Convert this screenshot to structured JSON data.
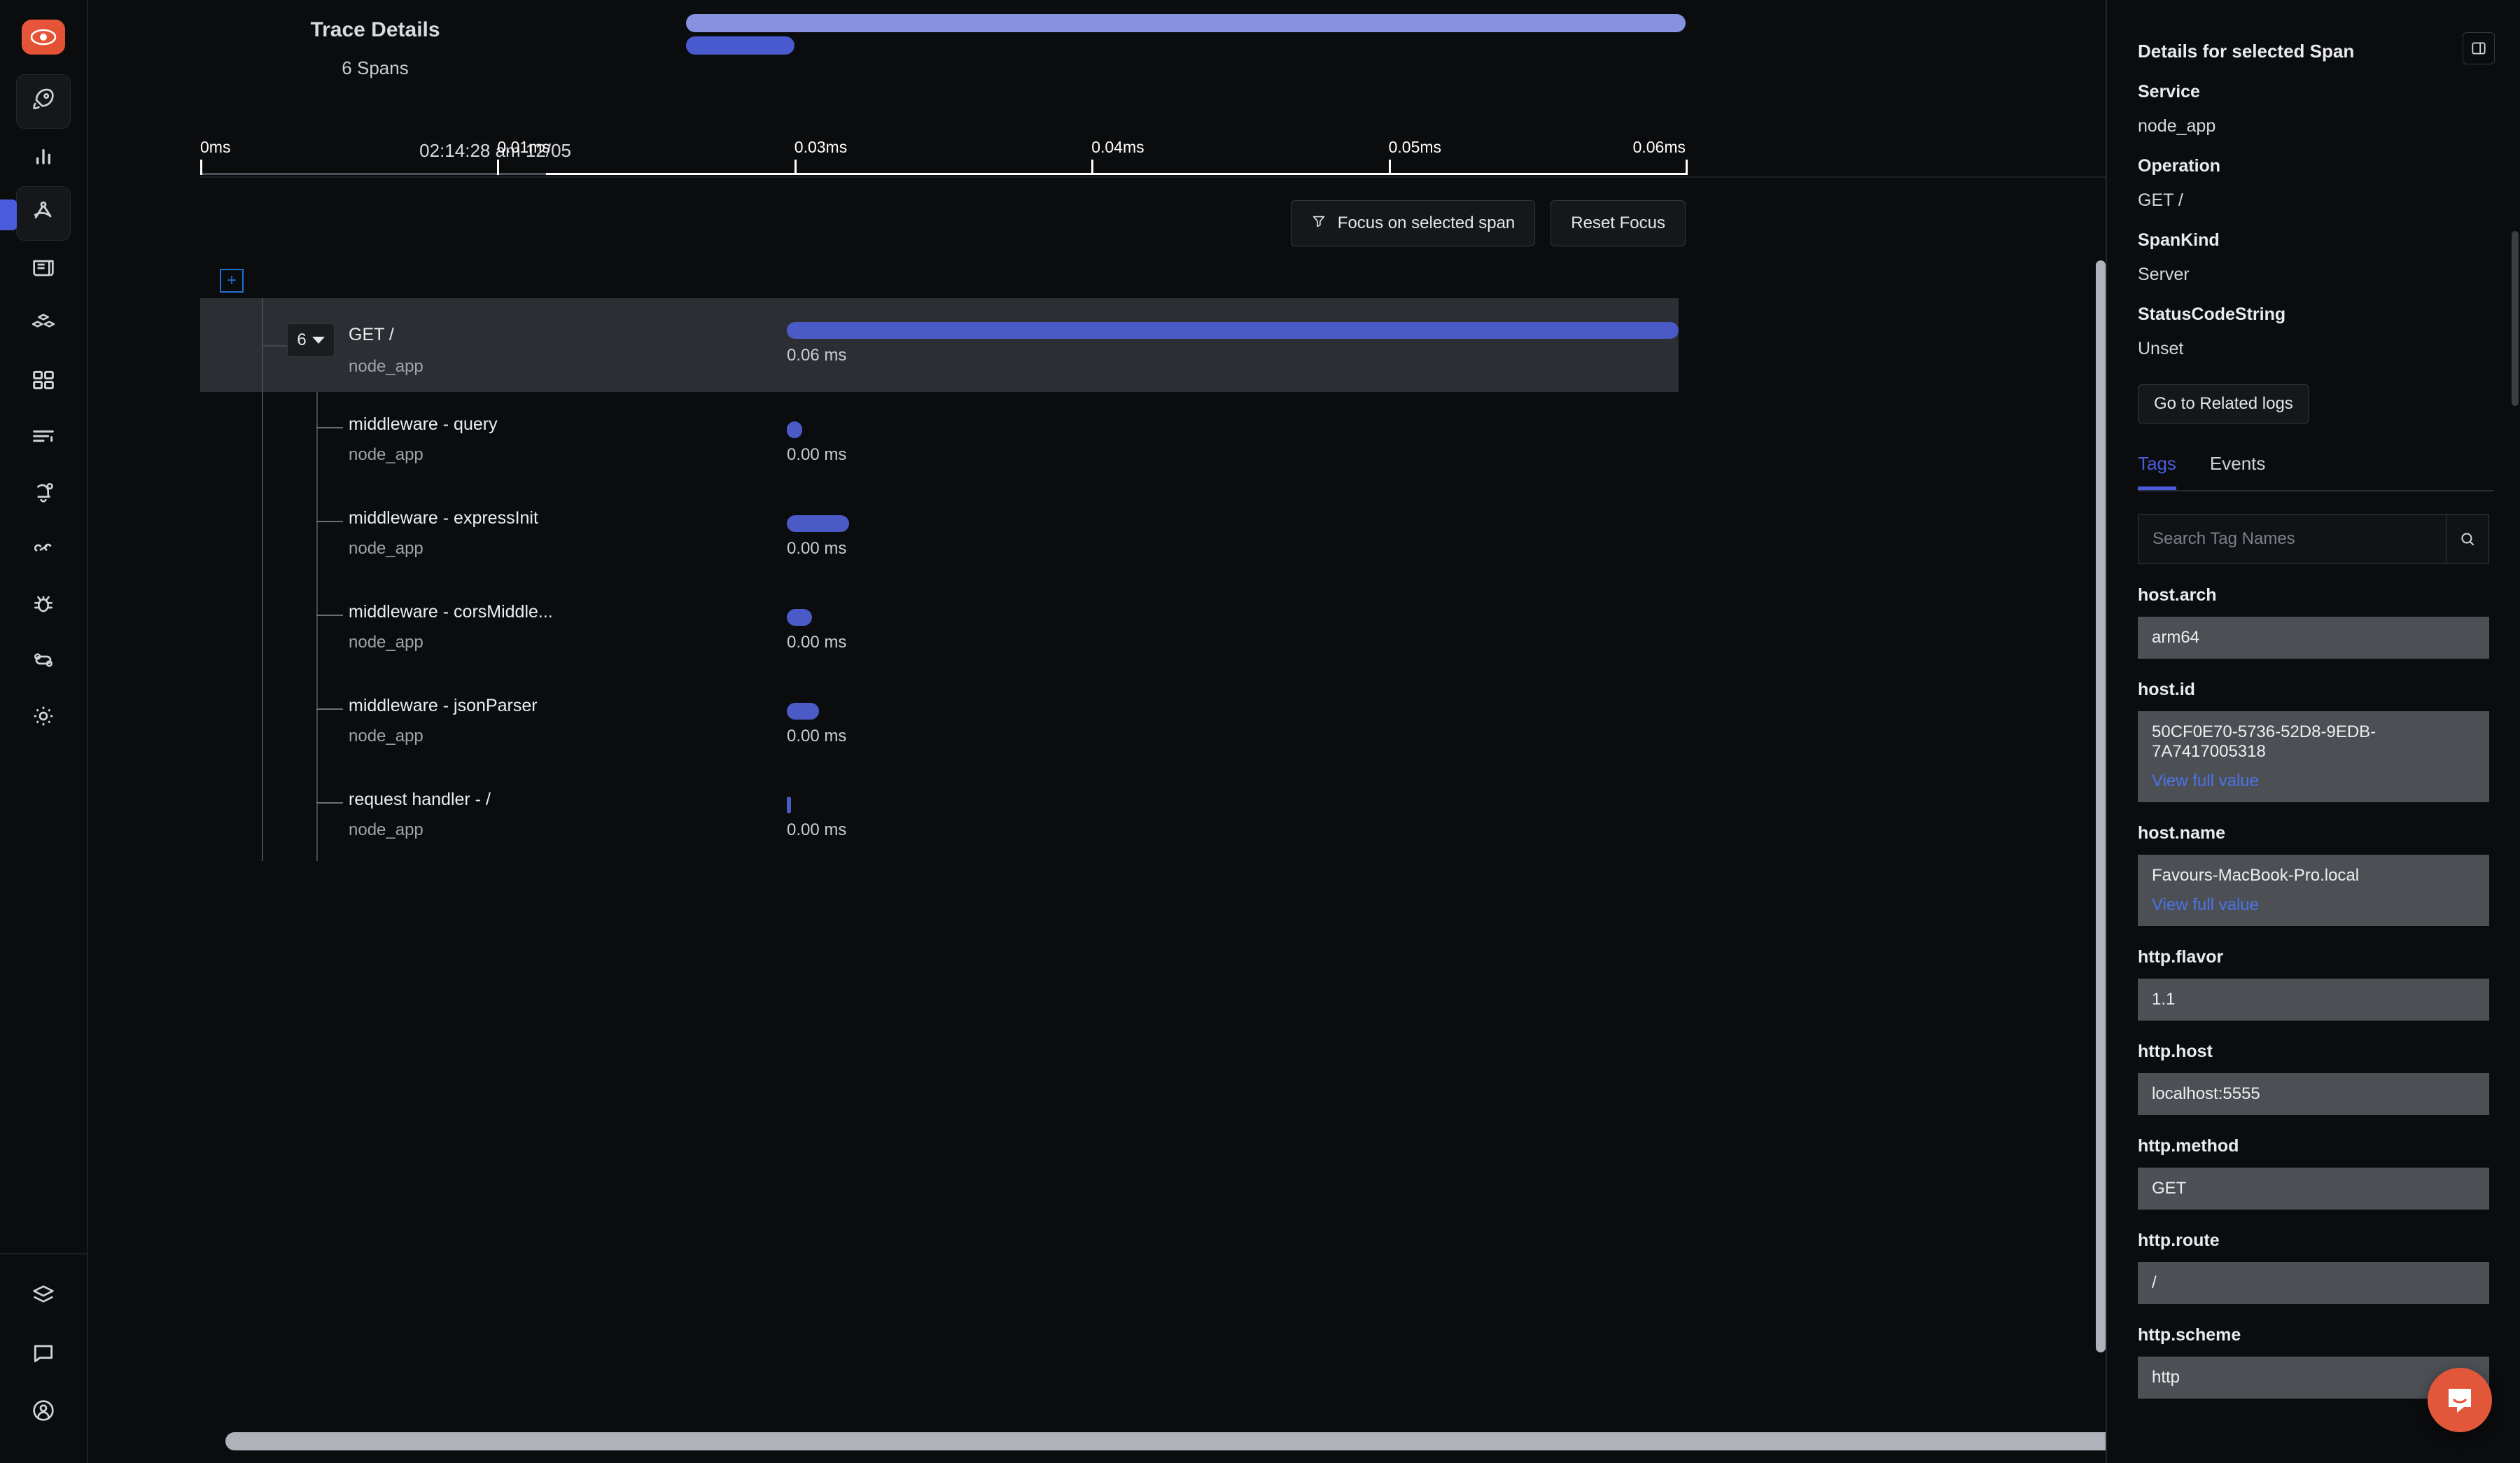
{
  "sidebar": {
    "logo_icon": "eye-logo-icon",
    "items": [
      {
        "icon": "rocket-icon",
        "name": "get-started",
        "active": false,
        "boxed": true
      },
      {
        "icon": "bar-chart-icon",
        "name": "metrics",
        "active": false,
        "boxed": false
      },
      {
        "icon": "traces-icon",
        "name": "traces",
        "active": true,
        "boxed": true
      },
      {
        "icon": "logs-icon",
        "name": "logs",
        "active": false,
        "boxed": false
      },
      {
        "icon": "cubes-icon",
        "name": "services",
        "active": false,
        "boxed": false
      },
      {
        "icon": "dashboard-grid-icon",
        "name": "dashboards",
        "active": false,
        "boxed": false
      },
      {
        "icon": "list-lines-icon",
        "name": "exceptions",
        "active": false,
        "boxed": false
      },
      {
        "icon": "bell-icon",
        "name": "alerts",
        "active": false,
        "boxed": false
      },
      {
        "icon": "pipeline-icon",
        "name": "pipelines",
        "active": false,
        "boxed": false
      },
      {
        "icon": "bug-icon",
        "name": "errors",
        "active": false,
        "boxed": false
      },
      {
        "icon": "workflow-icon",
        "name": "workflows",
        "active": false,
        "boxed": false
      },
      {
        "icon": "gear-icon",
        "name": "settings",
        "active": false,
        "boxed": false
      }
    ],
    "bottom_items": [
      {
        "icon": "layers-icon",
        "name": "integrations"
      },
      {
        "icon": "chat-bubble-icon",
        "name": "support"
      },
      {
        "icon": "user-circle-icon",
        "name": "account"
      }
    ]
  },
  "trace": {
    "title": "Trace Details",
    "spans_count": "6 Spans",
    "start_time": "02:14:28 am 12/05",
    "ticks": [
      {
        "label": "0ms",
        "pct": 0
      },
      {
        "label": "0.01ms",
        "pct": 20
      },
      {
        "label": "0.03ms",
        "pct": 40
      },
      {
        "label": "0.04ms",
        "pct": 60
      },
      {
        "label": "0.05ms",
        "pct": 80
      },
      {
        "label": "0.06ms",
        "pct": 100
      }
    ],
    "minimap": {
      "full_pct": 100,
      "selected_pct": 7
    }
  },
  "toolbar": {
    "focus_label": "Focus on selected span",
    "focus_icon": "funnel-icon",
    "reset_label": "Reset Focus",
    "expand_icon": "expand-plus-icon"
  },
  "spans": [
    {
      "name": "GET /",
      "service": "node_app",
      "duration": "0.06 ms",
      "bar_pct": 100,
      "bar_left_pct": 0,
      "depth": 0,
      "selected": true,
      "children_count": "6"
    },
    {
      "name": "middleware - query",
      "service": "node_app",
      "duration": "0.00 ms",
      "bar_pct": 1.7,
      "bar_left_pct": 0,
      "depth": 1,
      "selected": false,
      "children_count": ""
    },
    {
      "name": "middleware - expressInit",
      "service": "node_app",
      "duration": "0.00 ms",
      "bar_pct": 7.0,
      "bar_left_pct": 0,
      "depth": 1,
      "selected": false,
      "children_count": ""
    },
    {
      "name": "middleware - corsMiddle...",
      "service": "node_app",
      "duration": "0.00 ms",
      "bar_pct": 2.8,
      "bar_left_pct": 0,
      "depth": 1,
      "selected": false,
      "children_count": ""
    },
    {
      "name": "middleware - jsonParser",
      "service": "node_app",
      "duration": "0.00 ms",
      "bar_pct": 3.6,
      "bar_left_pct": 0,
      "depth": 1,
      "selected": false,
      "children_count": ""
    },
    {
      "name": "request handler - /",
      "service": "node_app",
      "duration": "0.00 ms",
      "bar_pct": 0.5,
      "bar_left_pct": 0,
      "depth": 1,
      "selected": false,
      "children_count": ""
    }
  ],
  "details": {
    "title": "Details for selected Span",
    "toggle_icon": "panel-toggle-icon",
    "fields": [
      {
        "label": "Service",
        "value": "node_app"
      },
      {
        "label": "Operation",
        "value": "GET /"
      },
      {
        "label": "SpanKind",
        "value": "Server"
      },
      {
        "label": "StatusCodeString",
        "value": "Unset"
      }
    ],
    "related_logs_label": "Go to Related logs",
    "tabs": [
      {
        "label": "Tags",
        "active": true
      },
      {
        "label": "Events",
        "active": false
      }
    ],
    "search": {
      "placeholder": "Search Tag Names",
      "value": "",
      "icon": "search-icon"
    },
    "view_full_label": "View full value",
    "tags": [
      {
        "key": "host.arch",
        "value": "arm64",
        "truncated": false
      },
      {
        "key": "host.id",
        "value": "50CF0E70-5736-52D8-9EDB-7A7417005318",
        "truncated": true
      },
      {
        "key": "host.name",
        "value": "Favours-MacBook-Pro.local",
        "truncated": true
      },
      {
        "key": "http.flavor",
        "value": "1.1",
        "truncated": false
      },
      {
        "key": "http.host",
        "value": "localhost:5555",
        "truncated": false
      },
      {
        "key": "http.method",
        "value": "GET",
        "truncated": false
      },
      {
        "key": "http.route",
        "value": "/",
        "truncated": false
      },
      {
        "key": "http.scheme",
        "value": "http",
        "truncated": false
      }
    ]
  },
  "widgets": {
    "intercom_icon": "intercom-chat-icon"
  },
  "colors": {
    "accent": "#4a5bdc",
    "bar": "#4a5bc7",
    "minimap": "#8691e0",
    "brand": "#e2563a",
    "link": "#4b73e8",
    "bg": "#0b0c0e",
    "selected_row": "#2c2e33"
  }
}
